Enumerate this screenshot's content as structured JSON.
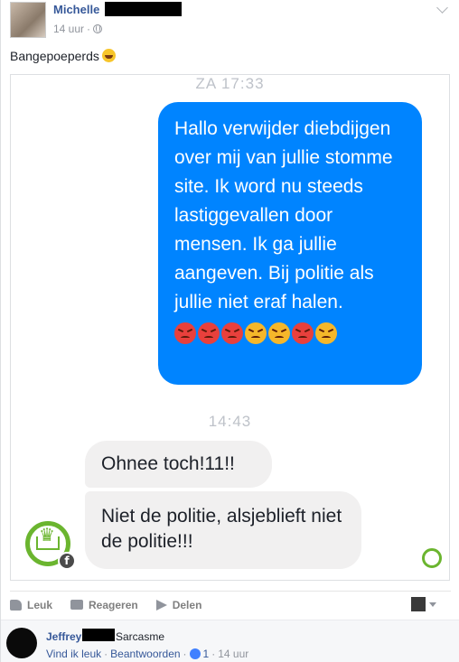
{
  "post": {
    "author": "Michelle",
    "time": "14 uur",
    "separator": "·",
    "caption": "Bangepoeperds"
  },
  "screenshot": {
    "timestamp1": "ZA 17:33",
    "blue_message": "Hallo verwijder diebdijgen over mij van jullie stomme site. Ik word nu steeds lastiggevallen door mensen. Ik ga jullie aangeven. Bij politie als jullie niet eraf halen.",
    "emojis": [
      "red",
      "red",
      "red",
      "yellow",
      "yellow",
      "red",
      "yellow"
    ],
    "timestamp2": "14:43",
    "reply1": "Ohnee toch!11!!",
    "reply2": "Niet de politie, alsjeblieft niet de politie!!!",
    "badge": "f"
  },
  "actions": {
    "like": "Leuk",
    "comment": "Reageren",
    "share": "Delen"
  },
  "comment": {
    "author": "Jeffrey",
    "text": "Sarcasme",
    "like_link": "Vind ik leuk",
    "reply_link": "Beantwoorden",
    "like_count": "1",
    "time": "14 uur",
    "sep": "·"
  },
  "colors": {
    "messenger_blue": "#0084ff",
    "link_blue": "#365899",
    "brand_green": "#6bb52f"
  }
}
